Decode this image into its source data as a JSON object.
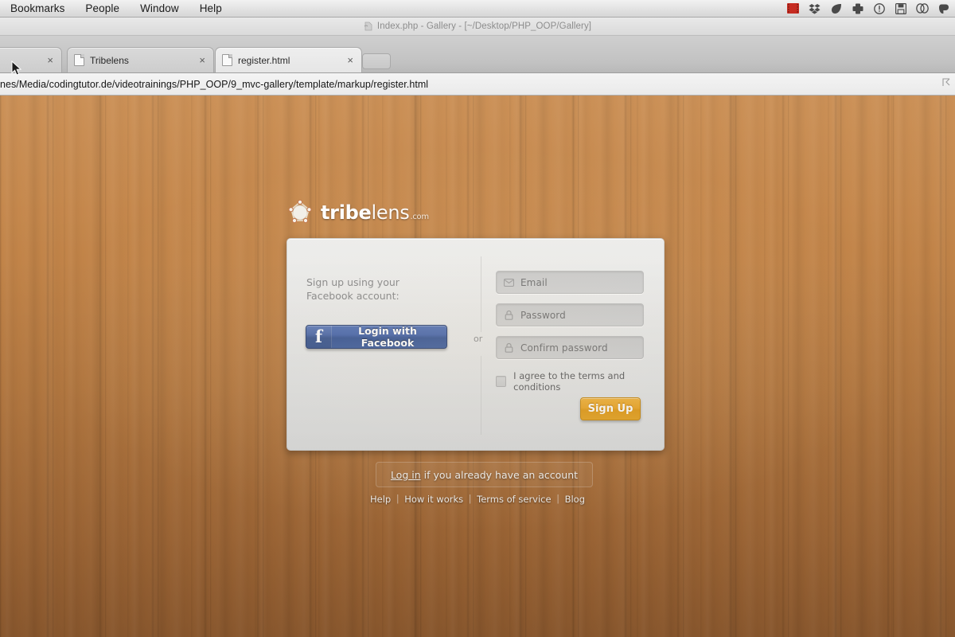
{
  "menubar": {
    "items": [
      {
        "label": "Bookmarks"
      },
      {
        "label": "People"
      },
      {
        "label": "Window"
      },
      {
        "label": "Help"
      }
    ],
    "tray": [
      {
        "name": "screen-recorder-icon"
      },
      {
        "name": "dropbox-icon"
      },
      {
        "name": "leaf-icon"
      },
      {
        "name": "plus-cross-icon"
      },
      {
        "name": "info-circle-icon"
      },
      {
        "name": "save-disk-icon"
      },
      {
        "name": "link-chain-icon"
      },
      {
        "name": "evernote-elephant-icon"
      }
    ]
  },
  "window": {
    "title": "Index.php - Gallery - [~/Desktop/PHP_OOP/Gallery]"
  },
  "browser": {
    "tabs": [
      {
        "label": "",
        "close": "×",
        "active": false
      },
      {
        "label": "Tribelens",
        "close": "×",
        "active": false
      },
      {
        "label": "register.html",
        "close": "×",
        "active": true
      }
    ],
    "new_tab_label": "",
    "url": "nes/Media/codingtutor.de/videotrainings/PHP_OOP/9_mvc-gallery/template/markup/register.html"
  },
  "brand": {
    "name_bold": "tribe",
    "name_light": "lens",
    "tld": ".com"
  },
  "signup": {
    "facebook_caption": "Sign up using your\nFacebook account:",
    "facebook_button": "Login with Facebook",
    "facebook_f": "f",
    "or": "or",
    "fields": [
      {
        "id": "fld-email",
        "placeholder": "Email",
        "icon": "envelope-icon"
      },
      {
        "id": "fld-pass",
        "placeholder": "Password",
        "icon": "lock-icon"
      },
      {
        "id": "fld-conf",
        "placeholder": "Confirm password",
        "icon": "lock-icon"
      }
    ],
    "agree_label": "I agree to the terms and conditions",
    "signup_button": "Sign Up"
  },
  "login": {
    "link_text": "Log in",
    "rest_text": " if you already have an account"
  },
  "footer": {
    "links": [
      "Help",
      "How it works",
      "Terms of service",
      "Blog"
    ],
    "separator": "|"
  },
  "colors": {
    "wood_light": "#c98c50",
    "wood_dark": "#9c6333",
    "panel_bg": "#e6e7e7",
    "facebook_blue": "#3a5795",
    "signup_orange": "#eda92c"
  }
}
